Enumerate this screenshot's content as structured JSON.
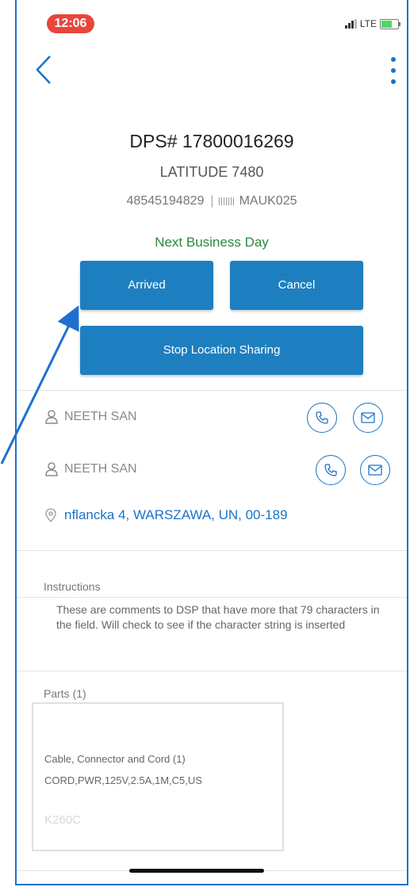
{
  "status_bar": {
    "time": "12:06",
    "network": "LTE"
  },
  "header": {
    "dps_number": "DPS# 17800016269",
    "model": "LATITUDE 7480",
    "serial": "48545194829",
    "separator": "|",
    "tag": "MAUK025",
    "service_level": "Next Business Day",
    "service_color": "#2a8a3a"
  },
  "actions": {
    "arrived_label": "Arrived",
    "cancel_label": "Cancel",
    "stop_sharing_label": "Stop Location Sharing",
    "button_color": "#1e7fc0"
  },
  "contacts": [
    {
      "name": "NEETH SAN"
    },
    {
      "name": "NEETH SAN"
    }
  ],
  "address": {
    "text": "nflancka 4, WARSZAWA, UN, 00-189"
  },
  "instructions": {
    "label": "Instructions",
    "text": "These are comments to DSP that have more that 79 characters in the field. Will check to see if the character string is inserted"
  },
  "parts": {
    "label": "Parts (1)",
    "items": [
      {
        "name": "Cable, Connector and Cord (1)",
        "description": "CORD,PWR,125V,2.5A,1M,C5,US",
        "code": "K260C"
      }
    ]
  },
  "icons": {
    "back": "chevron-left-icon",
    "more": "more-vertical-icon",
    "person": "person-icon",
    "phone": "phone-icon",
    "mail": "mail-icon",
    "location": "location-pin-icon",
    "barcode": "barcode-icon"
  },
  "accent_color": "#1a73c8"
}
